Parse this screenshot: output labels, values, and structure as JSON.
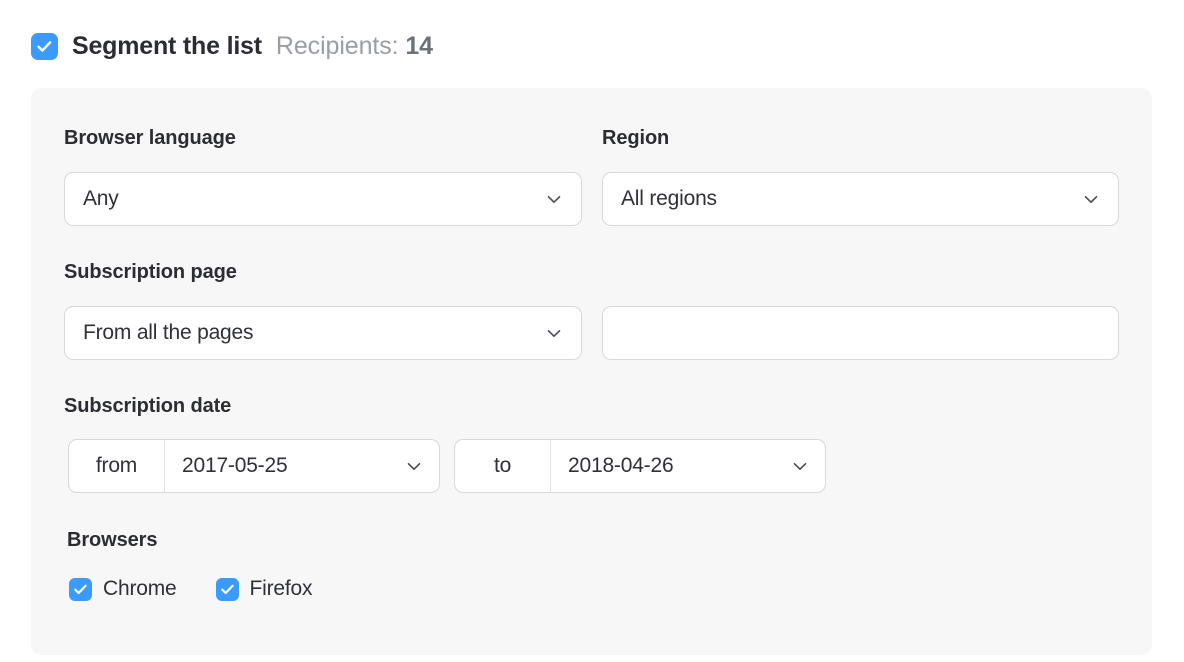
{
  "header": {
    "checkbox_checked": true,
    "title": "Segment the list",
    "recipients_label": "Recipients:",
    "recipients_count": "14",
    "accent_color": "#3a9bfc"
  },
  "panel": {
    "background_color": "#f7f7f8",
    "fields": {
      "browser_language": {
        "label": "Browser language",
        "value": "Any"
      },
      "region": {
        "label": "Region",
        "value": "All regions"
      },
      "subscription_page": {
        "label": "Subscription page",
        "value": "From all the pages"
      },
      "subscription_page_url": {
        "value": "",
        "placeholder": ""
      },
      "subscription_date": {
        "label": "Subscription date",
        "from_label": "from",
        "from_value": "2017-05-25",
        "to_label": "to",
        "to_value": "2018-04-26"
      },
      "browsers": {
        "label": "Browsers",
        "options": [
          {
            "label": "Chrome",
            "checked": true
          },
          {
            "label": "Firefox",
            "checked": true
          }
        ]
      }
    }
  }
}
